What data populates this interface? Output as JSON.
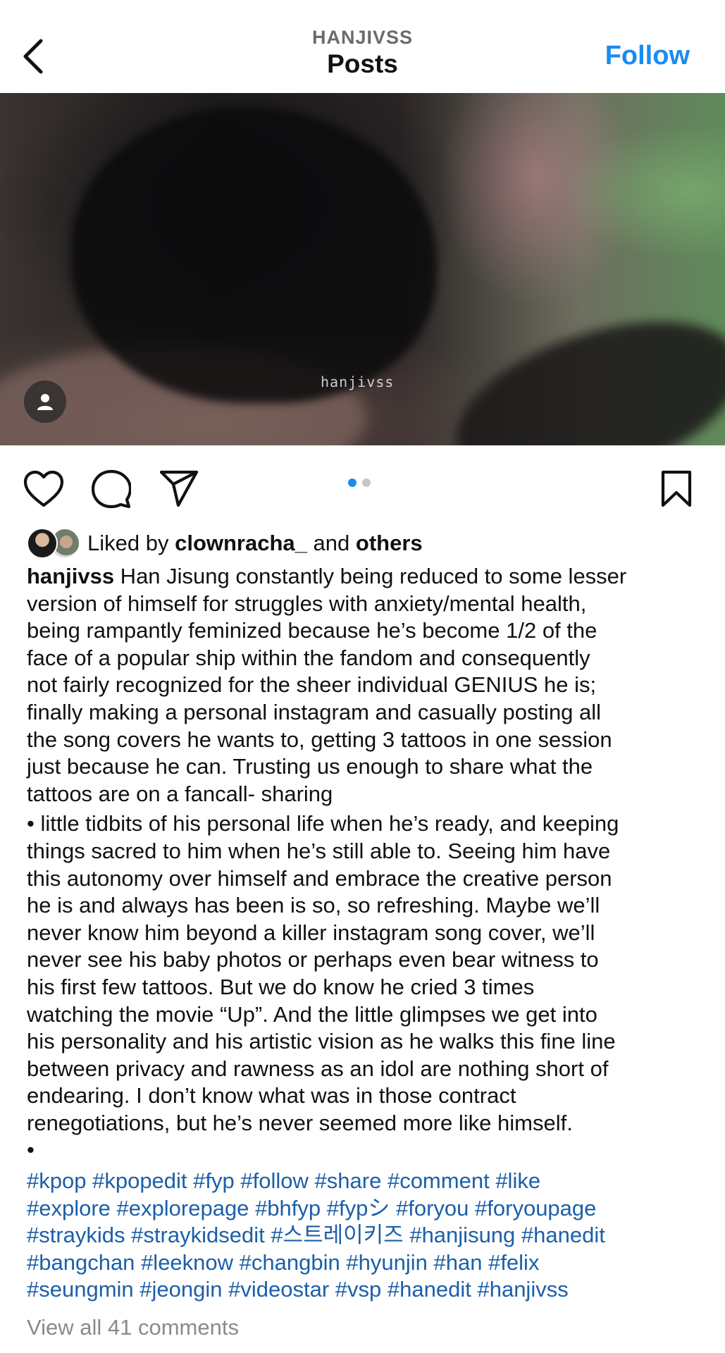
{
  "header": {
    "account_name": "HANJIVSS",
    "title": "Posts",
    "follow_label": "Follow"
  },
  "media": {
    "watermark": "hanjivss",
    "carousel": {
      "current": 1,
      "total": 2
    }
  },
  "likes": {
    "prefix": "Liked by",
    "user": "clownracha_",
    "connector": "and",
    "others": "others"
  },
  "caption": {
    "username": "hanjivss",
    "para1_lines": [
      "Han Jisung constantly being reduced to some lesser",
      "version of himself for struggles with anxiety/mental health,",
      "being rampantly feminized because he’s become 1/2 of the",
      "face of a popular ship within the fandom and consequently",
      "not fairly recognized for the sheer individual GENIUS he is;",
      "finally making a personal instagram and casually posting all",
      "the song covers he wants to, getting 3 tattoos in one session",
      "just because he can. Trusting us enough to share what the",
      "tattoos are on a fancall- sharing"
    ],
    "para2_lines": [
      "• little tidbits of his personal life when he’s ready, and keeping",
      "things sacred to him when he’s still able to. Seeing him have",
      "this autonomy over himself and embrace the creative person",
      "he is and always has been is so, so refreshing. Maybe we’ll",
      "never know him beyond a killer instagram song cover, we’ll",
      "never see his baby photos or perhaps even bear witness to",
      "his first few tattoos. But we do know he cried 3 times",
      "watching the movie “Up”. And the little glimpses we get into",
      "his personality and his artistic vision as he walks this fine line",
      "between privacy and rawness as an idol are nothing short of",
      "endearing. I don’t know what was in those contract",
      "renegotiations, but he’s never seemed more like himself."
    ],
    "bullet": "•"
  },
  "hashtags": [
    [
      "#kpop",
      "#kpopedit",
      "#fyp",
      "#follow",
      "#share",
      "#comment",
      "#like"
    ],
    [
      "#explore",
      "#explorepage",
      "#bhfyp",
      "#fypシ",
      "#foryou",
      "#foryoupage"
    ],
    [
      "#straykids",
      "#straykidsedit",
      "#스트레이키즈",
      "#hanjisung",
      "#hanedit"
    ],
    [
      "#bangchan",
      "#leeknow",
      "#changbin",
      "#hyunjin",
      "#han",
      "#felix"
    ],
    [
      "#seungmin",
      "#jeongin",
      "#videostar",
      "#vsp",
      "#hanedit",
      "#hanjivss"
    ]
  ],
  "comments": {
    "view_all_label": "View all 41 comments"
  },
  "icons": {
    "back": "chevron-left-icon",
    "user_tag": "person-icon",
    "like": "heart-icon",
    "comment": "speech-bubble-icon",
    "share": "paper-plane-icon",
    "save": "bookmark-icon"
  },
  "colors": {
    "accent": "#1a8cf0",
    "hashtag": "#1c5fa8",
    "muted": "#8a8a8a"
  }
}
